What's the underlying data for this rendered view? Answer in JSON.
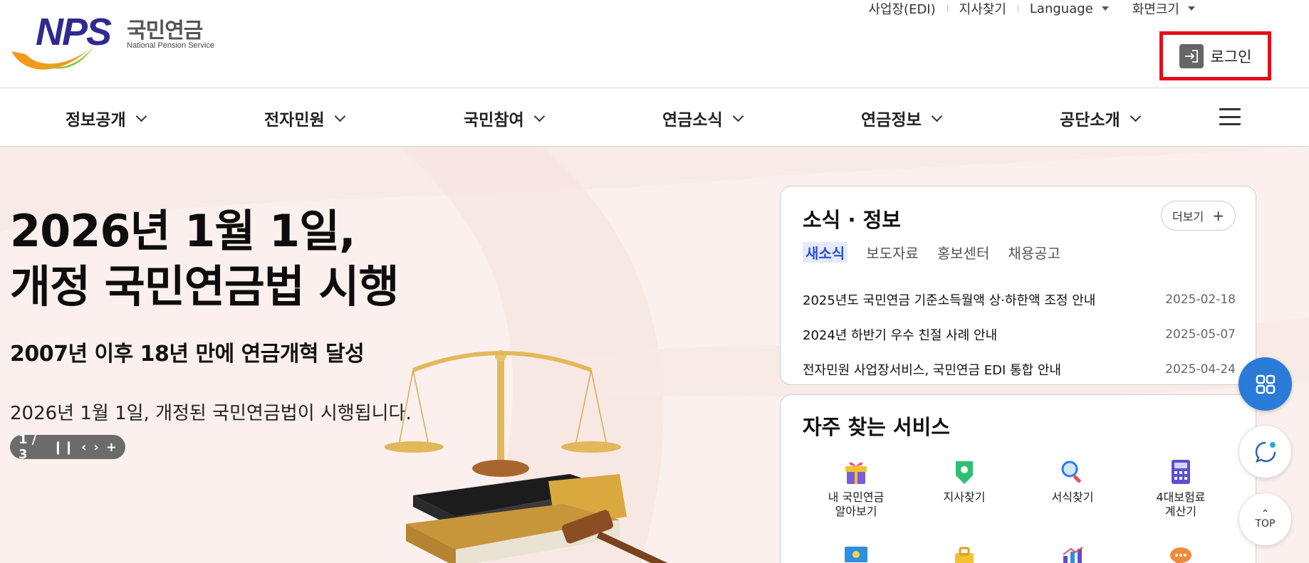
{
  "logo": {
    "brand": "NPS",
    "name_ko": "국민연금",
    "name_en": "National Pension Service"
  },
  "util": {
    "items": [
      "사업장(EDI)",
      "지사찾기",
      "Language",
      "화면크기"
    ]
  },
  "login": {
    "label": "로그인"
  },
  "gnb": {
    "items": [
      "정보공개",
      "전자민원",
      "국민참여",
      "연금소식",
      "연금정보",
      "공단소개"
    ]
  },
  "hero": {
    "title_line1": "2026년 1월 1일,",
    "title_line2": "개정 국민연금법 시행",
    "subtitle": "2007년 이후 18년 만에 연금개혁 달성",
    "description": "2026년 1월 1일, 개정된 국민연금법이 시행됩니다.",
    "pager": "1 / 3"
  },
  "news": {
    "title": "소식 · 정보",
    "more": "더보기",
    "tabs": [
      "새소식",
      "보도자료",
      "홍보센터",
      "채용공고"
    ],
    "items": [
      {
        "title": "2025년도 국민연금 기준소득월액 상·하한액 조정 안내",
        "date": "2025-02-18"
      },
      {
        "title": "2024년 하반기 우수 친절 사례 안내",
        "date": "2025-05-07"
      },
      {
        "title": "전자민원 사업장서비스, 국민연금 EDI 통합 안내",
        "date": "2025-04-24"
      }
    ]
  },
  "services": {
    "title": "자주 찾는 서비스",
    "items": [
      {
        "label": "내 국민연금\n알아보기",
        "icon": "gift-icon"
      },
      {
        "label": "지사찾기",
        "icon": "map-pin-icon"
      },
      {
        "label": "서식찾기",
        "icon": "magnifier-icon"
      },
      {
        "label": "4대보험료\n계산기",
        "icon": "calculator-icon"
      },
      {
        "label": "",
        "icon": "monitor-icon"
      },
      {
        "label": "",
        "icon": "briefcase-icon"
      },
      {
        "label": "",
        "icon": "bar-chart-icon"
      },
      {
        "label": "",
        "icon": "speech-bubble-icon"
      }
    ]
  },
  "fab": {
    "top_label": "TOP"
  },
  "colors": {
    "accent": "#2a7bd8",
    "highlight_box": "#e0101a",
    "brand": "#2f2a8f",
    "hero_bg": "#fbf0ed"
  }
}
